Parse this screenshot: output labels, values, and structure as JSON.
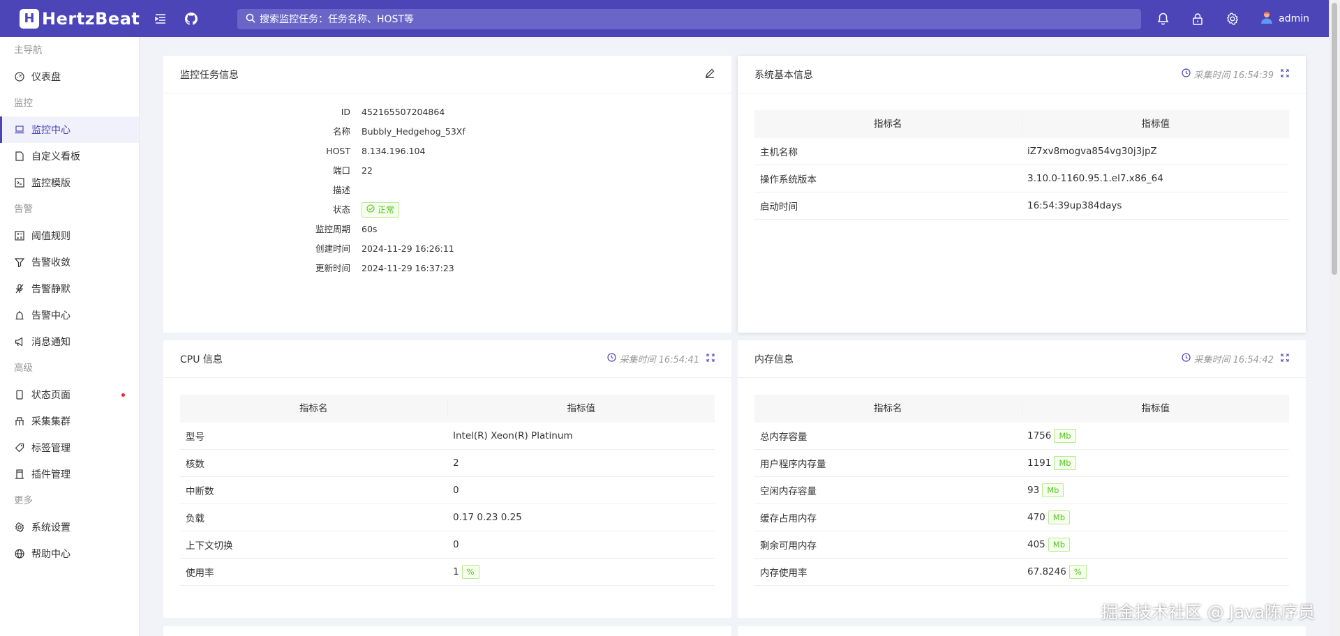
{
  "header": {
    "logo_text": "HertzBeat",
    "search_placeholder": "搜索监控任务：任务名称、HOST等",
    "user_name": "admin"
  },
  "sidebar": {
    "groups": [
      {
        "label": "主导航",
        "items": [
          {
            "label": "仪表盘",
            "icon": "dashboard-icon"
          }
        ]
      },
      {
        "label": "监控",
        "items": [
          {
            "label": "监控中心",
            "icon": "laptop-icon",
            "active": true
          },
          {
            "label": "自定义看板",
            "icon": "file-icon"
          },
          {
            "label": "监控模版",
            "icon": "code-icon"
          }
        ]
      },
      {
        "label": "告警",
        "items": [
          {
            "label": "阈值规则",
            "icon": "calculator-icon"
          },
          {
            "label": "告警收敛",
            "icon": "filter-icon"
          },
          {
            "label": "告警静默",
            "icon": "mute-icon"
          },
          {
            "label": "告警中心",
            "icon": "alert-icon"
          },
          {
            "label": "消息通知",
            "icon": "notification-icon"
          }
        ]
      },
      {
        "label": "高级",
        "items": [
          {
            "label": "状态页面",
            "icon": "mobile-icon",
            "dot": true
          },
          {
            "label": "采集集群",
            "icon": "cluster-icon"
          },
          {
            "label": "标签管理",
            "icon": "tag-icon"
          },
          {
            "label": "插件管理",
            "icon": "plugin-icon"
          }
        ]
      },
      {
        "label": "更多",
        "items": [
          {
            "label": "系统设置",
            "icon": "setting-icon"
          },
          {
            "label": "帮助中心",
            "icon": "global-icon"
          }
        ]
      }
    ]
  },
  "monitor_info": {
    "title": "监控任务信息",
    "rows": [
      {
        "label": "ID",
        "value": "452165507204864"
      },
      {
        "label": "名称",
        "value": "Bubbly_Hedgehog_53Xf"
      },
      {
        "label": "HOST",
        "value": "8.134.196.104"
      },
      {
        "label": "端口",
        "value": "22"
      },
      {
        "label": "描述",
        "value": ""
      },
      {
        "label": "状态",
        "value": "正常"
      },
      {
        "label": "监控周期",
        "value": "60s"
      },
      {
        "label": "创建时间",
        "value": "2024-11-29 16:26:11"
      },
      {
        "label": "更新时间",
        "value": "2024-11-29 16:37:23"
      }
    ]
  },
  "system_info": {
    "title": "系统基本信息",
    "collect_time": "采集时间 16:54:39",
    "col_name": "指标名",
    "col_value": "指标值",
    "rows": [
      {
        "name": "主机名称",
        "value": "iZ7xv8mogva854vg30j3jpZ"
      },
      {
        "name": "操作系统版本",
        "value": "3.10.0-1160.95.1.el7.x86_64"
      },
      {
        "name": "启动时间",
        "value": "16:54:39up384days"
      }
    ]
  },
  "cpu_info": {
    "title": "CPU 信息",
    "collect_time": "采集时间 16:54:41",
    "col_name": "指标名",
    "col_value": "指标值",
    "rows": [
      {
        "name": "型号",
        "value": "Intel(R) Xeon(R) Platinum",
        "unit": ""
      },
      {
        "name": "核数",
        "value": "2",
        "unit": ""
      },
      {
        "name": "中断数",
        "value": "0",
        "unit": ""
      },
      {
        "name": "负载",
        "value": "0.17 0.23 0.25",
        "unit": ""
      },
      {
        "name": "上下文切换",
        "value": "0",
        "unit": ""
      },
      {
        "name": "使用率",
        "value": "1",
        "unit": "%"
      }
    ]
  },
  "memory_info": {
    "title": "内存信息",
    "collect_time": "采集时间 16:54:42",
    "col_name": "指标名",
    "col_value": "指标值",
    "rows": [
      {
        "name": "总内存容量",
        "value": "1756",
        "unit": "Mb"
      },
      {
        "name": "用户程序内存量",
        "value": "1191",
        "unit": "Mb"
      },
      {
        "name": "空闲内存容量",
        "value": "93",
        "unit": "Mb"
      },
      {
        "name": "缓存占用内存",
        "value": "470",
        "unit": "Mb"
      },
      {
        "name": "剩余可用内存",
        "value": "405",
        "unit": "Mb"
      },
      {
        "name": "内存使用率",
        "value": "67.8246",
        "unit": "%"
      }
    ]
  },
  "watermark": "掘金技术社区 @ Java陈序员",
  "colors": {
    "primary": "#4b45b8",
    "success": "#52c41a",
    "danger": "#f5222d"
  }
}
